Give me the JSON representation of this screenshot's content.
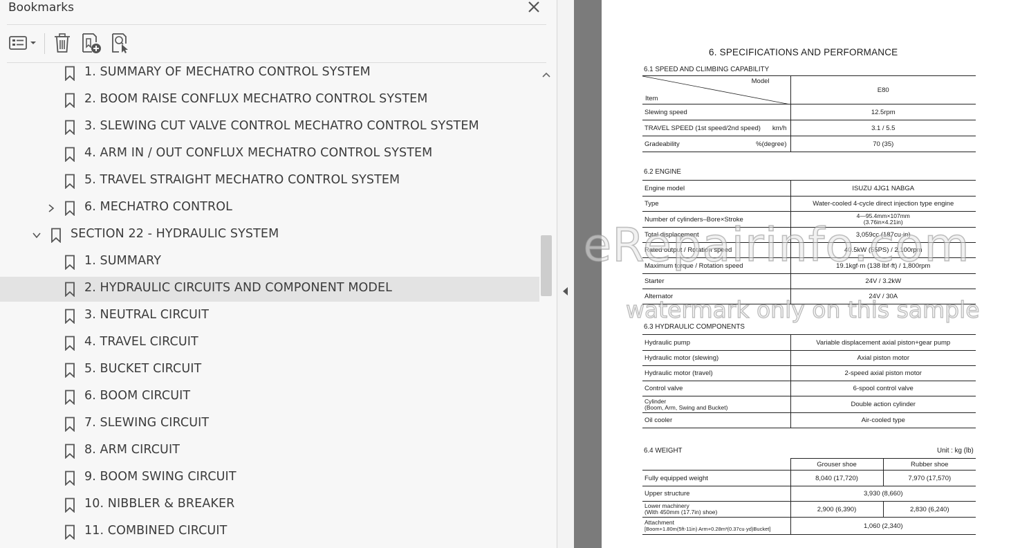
{
  "panel": {
    "title": "Bookmarks",
    "toolbar": {
      "options": "options-icon",
      "delete": "delete-bookmark-icon",
      "new": "new-bookmark-icon",
      "find": "find-current-bookmark-icon"
    }
  },
  "bookmarks": [
    {
      "label": "1. SUMMARY OF MECHATRO CONTROL SYSTEM",
      "level": 2
    },
    {
      "label": "2. BOOM RAISE CONFLUX MECHATRO CONTROL SYSTEM",
      "level": 2
    },
    {
      "label": "3. SLEWING CUT VALVE CONTROL MECHATRO CONTROL SYSTEM",
      "level": 2
    },
    {
      "label": "4. ARM IN / OUT CONFLUX MECHATRO CONTROL SYSTEM",
      "level": 2
    },
    {
      "label": "5. TRAVEL STRAIGHT MECHATRO CONTROL SYSTEM",
      "level": 2
    },
    {
      "label": "6. MECHATRO CONTROL",
      "level": 2,
      "expander": "collapsed"
    },
    {
      "label": "SECTION 22 - HYDRAULIC SYSTEM",
      "level": 1,
      "expander": "expanded"
    },
    {
      "label": "1. SUMMARY",
      "level": 2
    },
    {
      "label": "2. HYDRAULIC CIRCUITS AND COMPONENT MODEL",
      "level": 2,
      "selected": true
    },
    {
      "label": "3. NEUTRAL CIRCUIT",
      "level": 2
    },
    {
      "label": "4. TRAVEL CIRCUIT",
      "level": 2
    },
    {
      "label": "5. BUCKET CIRCUIT",
      "level": 2
    },
    {
      "label": "6. BOOM CIRCUIT",
      "level": 2
    },
    {
      "label": "7. SLEWING CIRCUIT",
      "level": 2
    },
    {
      "label": "8. ARM CIRCUIT",
      "level": 2
    },
    {
      "label": "9. BOOM SWING CIRCUIT",
      "level": 2
    },
    {
      "label": "10. NIBBLER & BREAKER",
      "level": 2
    },
    {
      "label": "11. COMBINED CIRCUIT",
      "level": 2
    }
  ],
  "document": {
    "title": "6.   SPECIFICATIONS AND PERFORMANCE",
    "s1": {
      "heading": "6.1  SPEED AND CLIMBING CAPABILITY",
      "model_label": "Model",
      "item_label": "Item",
      "model": "E80",
      "rows": [
        {
          "item": "Slewing speed",
          "unit": "",
          "value": "12.5rpm"
        },
        {
          "item": "TRAVEL SPEED (1st speed/2nd speed)",
          "unit": "km/h",
          "value": "3.1 / 5.5"
        },
        {
          "item": "Gradeability",
          "unit": "%(degree)",
          "value": "70 (35)"
        }
      ]
    },
    "s2": {
      "heading": "6.2  ENGINE",
      "rows": [
        {
          "item": "Engine model",
          "value": "ISUZU 4JG1 NABGA"
        },
        {
          "item": "Type",
          "value": "Water-cooled 4-cycle direct injection type engine"
        },
        {
          "item": "Number of cylinders–Bore×Stroke",
          "value": "4—95.4mm×107mm",
          "value2": "(3.76in×4.21in)"
        },
        {
          "item": "Total displacement",
          "value": "3,059cc (187cu·in)"
        },
        {
          "item": "Rated output / Rotation speed",
          "value": "40.5kW (55PS) / 2,100rpm"
        },
        {
          "item": "Maximum torque / Rotation speed",
          "value": "19.1kgf·m (138 lbf·ft) / 1,800rpm"
        },
        {
          "item": "Starter",
          "value": "24V / 3.2kW"
        },
        {
          "item": "Alternator",
          "value": "24V / 30A"
        }
      ]
    },
    "s3": {
      "heading": "6.3  HYDRAULIC COMPONENTS",
      "rows": [
        {
          "item": "Hydraulic pump",
          "value": "Variable displacement axial piston+gear pump"
        },
        {
          "item": "Hydraulic motor (slewing)",
          "value": "Axial piston motor"
        },
        {
          "item": "Hydraulic motor (travel)",
          "value": "2-speed axial piston motor"
        },
        {
          "item": "Control valve",
          "value": "6-spool control valve"
        },
        {
          "item": "Cylinder",
          "item2": "(Boom, Arm, Swing and Bucket)",
          "value": "Double action cylinder"
        },
        {
          "item": "Oil cooler",
          "value": "Air-cooled type"
        }
      ]
    },
    "s4": {
      "heading": "6.4    WEIGHT",
      "unit": "Unit : kg (lb)",
      "col1": "Grouser shoe",
      "col2": "Rubber shoe",
      "rows": [
        {
          "item": "Fully equipped weight",
          "v1": "8,040 (17,720)",
          "v2": "7,970 (17,570)"
        },
        {
          "item": "Upper structure",
          "v": "3,930 (8,660)"
        },
        {
          "item": "Lower machinery",
          "item2": "(With 450mm (17.7in) shoe)",
          "v1": "2,900 (6,390)",
          "v2": "2,830 (6,240)"
        },
        {
          "item": "Attachment",
          "item2": "[Boom+1.80m(5ft-11in) Arm+0.28m³(0.37cu·yd)Bucket]",
          "v": "1,060 (2,340)"
        }
      ]
    },
    "watermark1": "eRepairinfo.com",
    "watermark2": "watermark only on this sample"
  }
}
